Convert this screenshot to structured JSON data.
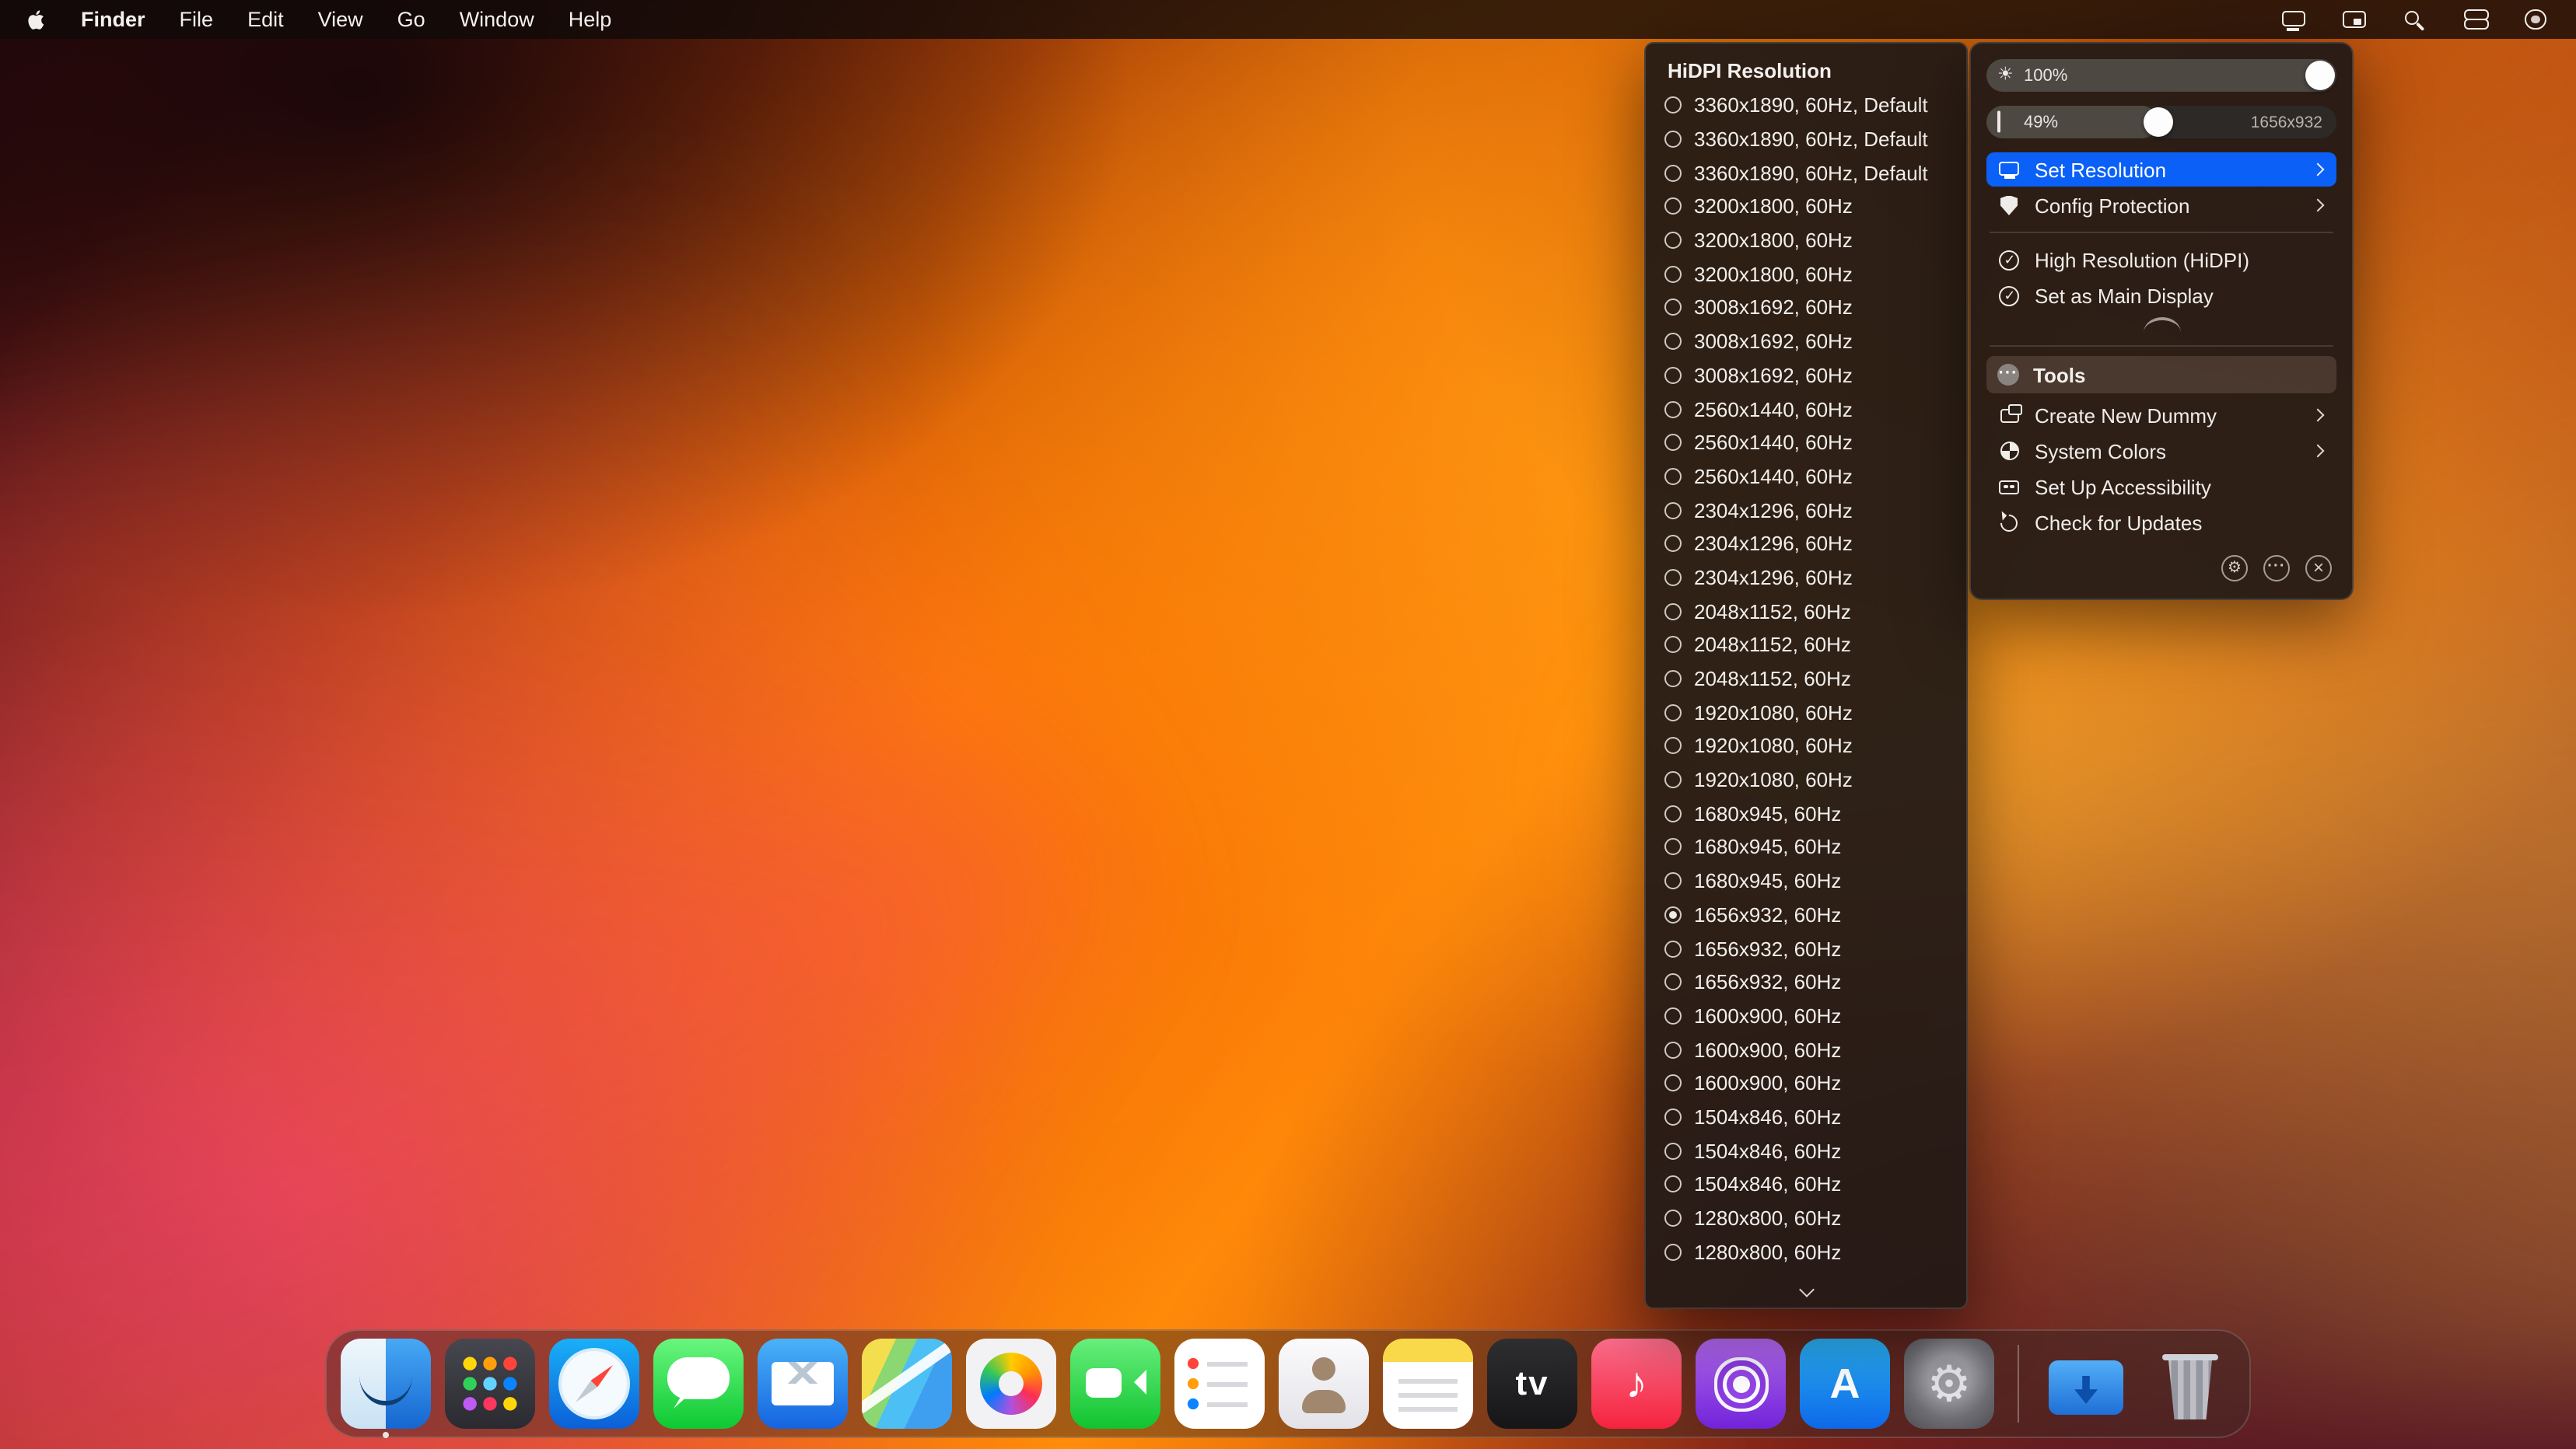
{
  "colors": {
    "accent": "#0a60f7"
  },
  "menu_bar": {
    "app_name": "Finder",
    "menus": [
      {
        "label": "File"
      },
      {
        "label": "Edit"
      },
      {
        "label": "View"
      },
      {
        "label": "Go"
      },
      {
        "label": "Window"
      },
      {
        "label": "Help"
      }
    ],
    "status_icons": [
      {
        "id": "display"
      },
      {
        "id": "window"
      },
      {
        "id": "spotlight"
      },
      {
        "id": "control-center"
      },
      {
        "id": "circle"
      }
    ]
  },
  "resolution_panel": {
    "title": "HiDPI Resolution",
    "options": [
      {
        "label": "3360x1890, 60Hz, Default",
        "selected": false
      },
      {
        "label": "3360x1890, 60Hz, Default",
        "selected": false
      },
      {
        "label": "3360x1890, 60Hz, Default",
        "selected": false
      },
      {
        "label": "3200x1800, 60Hz",
        "selected": false
      },
      {
        "label": "3200x1800, 60Hz",
        "selected": false
      },
      {
        "label": "3200x1800, 60Hz",
        "selected": false
      },
      {
        "label": "3008x1692, 60Hz",
        "selected": false
      },
      {
        "label": "3008x1692, 60Hz",
        "selected": false
      },
      {
        "label": "3008x1692, 60Hz",
        "selected": false
      },
      {
        "label": "2560x1440, 60Hz",
        "selected": false
      },
      {
        "label": "2560x1440, 60Hz",
        "selected": false
      },
      {
        "label": "2560x1440, 60Hz",
        "selected": false
      },
      {
        "label": "2304x1296, 60Hz",
        "selected": false
      },
      {
        "label": "2304x1296, 60Hz",
        "selected": false
      },
      {
        "label": "2304x1296, 60Hz",
        "selected": false
      },
      {
        "label": "2048x1152, 60Hz",
        "selected": false
      },
      {
        "label": "2048x1152, 60Hz",
        "selected": false
      },
      {
        "label": "2048x1152, 60Hz",
        "selected": false
      },
      {
        "label": "1920x1080, 60Hz",
        "selected": false
      },
      {
        "label": "1920x1080, 60Hz",
        "selected": false
      },
      {
        "label": "1920x1080, 60Hz",
        "selected": false
      },
      {
        "label": "1680x945, 60Hz",
        "selected": false
      },
      {
        "label": "1680x945, 60Hz",
        "selected": false
      },
      {
        "label": "1680x945, 60Hz",
        "selected": false
      },
      {
        "label": "1656x932, 60Hz",
        "selected": true
      },
      {
        "label": "1656x932, 60Hz",
        "selected": false
      },
      {
        "label": "1656x932, 60Hz",
        "selected": false
      },
      {
        "label": "1600x900, 60Hz",
        "selected": false
      },
      {
        "label": "1600x900, 60Hz",
        "selected": false
      },
      {
        "label": "1600x900, 60Hz",
        "selected": false
      },
      {
        "label": "1504x846, 60Hz",
        "selected": false
      },
      {
        "label": "1504x846, 60Hz",
        "selected": false
      },
      {
        "label": "1504x846, 60Hz",
        "selected": false
      },
      {
        "label": "1280x800, 60Hz",
        "selected": false
      },
      {
        "label": "1280x800, 60Hz",
        "selected": false
      }
    ]
  },
  "control_panel": {
    "brightness": {
      "value_label": "100%",
      "percent": 100
    },
    "scale": {
      "value_label": "49%",
      "percent": 49,
      "right_label": "1656x932"
    },
    "actions": [
      {
        "label": "Set Resolution",
        "icon": "display",
        "chevron": true,
        "highlighted": true
      },
      {
        "label": "Config Protection",
        "icon": "shield",
        "chevron": true,
        "highlighted": false
      }
    ],
    "display_toggles": [
      {
        "label": "High Resolution (HiDPI)",
        "icon": "check",
        "chevron": false
      },
      {
        "label": "Set as Main Display",
        "icon": "check",
        "chevron": false
      }
    ],
    "tools_header": {
      "label": "Tools"
    },
    "tools": [
      {
        "label": "Create New Dummy",
        "icon": "dummy",
        "chevron": true
      },
      {
        "label": "System Colors",
        "icon": "colors",
        "chevron": true
      },
      {
        "label": "Set Up Accessibility",
        "icon": "access",
        "chevron": false
      },
      {
        "label": "Check for Updates",
        "icon": "update",
        "chevron": false
      }
    ],
    "footer_icons": [
      {
        "id": "settings"
      },
      {
        "id": "more"
      },
      {
        "id": "close"
      }
    ]
  },
  "dock": {
    "apps": [
      {
        "id": "finder",
        "name": "Finder",
        "running": true
      },
      {
        "id": "launchpad",
        "name": "Launchpad",
        "running": false
      },
      {
        "id": "safari",
        "name": "Safari",
        "running": false
      },
      {
        "id": "messages",
        "name": "Messages",
        "running": false
      },
      {
        "id": "mail",
        "name": "Mail",
        "running": false
      },
      {
        "id": "maps",
        "name": "Maps",
        "running": false
      },
      {
        "id": "photos",
        "name": "Photos",
        "running": false
      },
      {
        "id": "facetime",
        "name": "FaceTime",
        "running": false
      },
      {
        "id": "reminders",
        "name": "Reminders",
        "running": false
      },
      {
        "id": "contacts",
        "name": "Contacts",
        "running": false
      },
      {
        "id": "notes",
        "name": "Notes",
        "running": false
      },
      {
        "id": "appletv",
        "name": "TV",
        "running": false
      },
      {
        "id": "music",
        "name": "Music",
        "running": false
      },
      {
        "id": "podcasts",
        "name": "Podcasts",
        "running": false
      },
      {
        "id": "appstore",
        "name": "App Store",
        "running": false
      },
      {
        "id": "settings",
        "name": "System Settings",
        "running": false
      },
      {
        "id": "divider",
        "name": "divider",
        "running": false
      },
      {
        "id": "downloads",
        "name": "Downloads",
        "running": false
      },
      {
        "id": "trash",
        "name": "Trash",
        "running": false
      }
    ]
  }
}
